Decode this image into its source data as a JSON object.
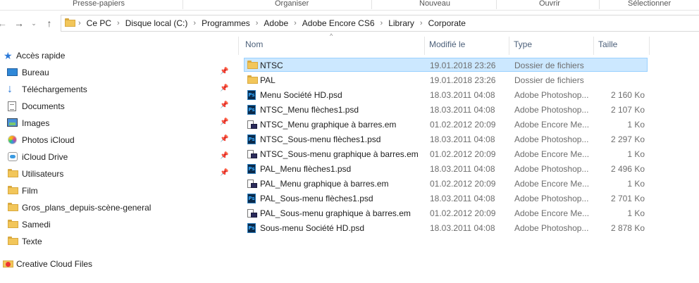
{
  "ribbon": {
    "groups": [
      "Presse-papiers",
      "Organiser",
      "Nouveau",
      "Ouvrir",
      "Sélectionner"
    ]
  },
  "nav": {
    "back_icon": "arrow-left-icon",
    "forward_icon": "arrow-right-icon",
    "up_icon": "arrow-up-icon",
    "breadcrumb": [
      "Ce PC",
      "Disque local (C:)",
      "Programmes",
      "Adobe",
      "Adobe Encore CS6",
      "Library",
      "Corporate"
    ]
  },
  "sidebar": {
    "items": [
      {
        "label": "Accès rapide",
        "icon": "star-icon",
        "pinned": false
      },
      {
        "label": "Bureau",
        "icon": "desktop-icon",
        "pinned": true
      },
      {
        "label": "Téléchargements",
        "icon": "download-icon",
        "pinned": true
      },
      {
        "label": "Documents",
        "icon": "documents-icon",
        "pinned": true
      },
      {
        "label": "Images",
        "icon": "pictures-icon",
        "pinned": true
      },
      {
        "label": "Photos iCloud",
        "icon": "icloud-photos-icon",
        "pinned": true
      },
      {
        "label": "iCloud Drive",
        "icon": "icloud-drive-icon",
        "pinned": true
      },
      {
        "label": "Utilisateurs",
        "icon": "folder-icon",
        "pinned": true
      },
      {
        "label": "Film",
        "icon": "folder-icon",
        "pinned": false
      },
      {
        "label": "Gros_plans_depuis-scène-general",
        "icon": "folder-icon",
        "pinned": false
      },
      {
        "label": "Samedi",
        "icon": "folder-icon",
        "pinned": false
      },
      {
        "label": "Texte",
        "icon": "folder-icon",
        "pinned": false
      },
      {
        "label": "Creative Cloud Files",
        "icon": "creative-cloud-folder-icon",
        "pinned": false
      }
    ]
  },
  "columns": {
    "name": "Nom",
    "modified": "Modifié le",
    "type": "Type",
    "size": "Taille"
  },
  "files": [
    {
      "name": "NTSC",
      "modified": "19.01.2018 23:26",
      "type": "Dossier de fichiers",
      "size": "",
      "icon": "folder-icon",
      "selected": true
    },
    {
      "name": "PAL",
      "modified": "19.01.2018 23:26",
      "type": "Dossier de fichiers",
      "size": "",
      "icon": "folder-icon",
      "selected": false
    },
    {
      "name": "Menu Société HD.psd",
      "modified": "18.03.2011 04:08",
      "type": "Adobe Photoshop...",
      "size": "2 160 Ko",
      "icon": "photoshop-file-icon",
      "selected": false
    },
    {
      "name": "NTSC_Menu flèches1.psd",
      "modified": "18.03.2011 04:08",
      "type": "Adobe Photoshop...",
      "size": "2 107 Ko",
      "icon": "photoshop-file-icon",
      "selected": false
    },
    {
      "name": "NTSC_Menu graphique à barres.em",
      "modified": "01.02.2012 20:09",
      "type": "Adobe Encore Me...",
      "size": "1 Ko",
      "icon": "encore-file-icon",
      "selected": false
    },
    {
      "name": "NTSC_Sous-menu flèches1.psd",
      "modified": "18.03.2011 04:08",
      "type": "Adobe Photoshop...",
      "size": "2 297 Ko",
      "icon": "photoshop-file-icon",
      "selected": false
    },
    {
      "name": "NTSC_Sous-menu graphique à barres.em",
      "modified": "01.02.2012 20:09",
      "type": "Adobe Encore Me...",
      "size": "1 Ko",
      "icon": "encore-file-icon",
      "selected": false
    },
    {
      "name": "PAL_Menu flèches1.psd",
      "modified": "18.03.2011 04:08",
      "type": "Adobe Photoshop...",
      "size": "2 496 Ko",
      "icon": "photoshop-file-icon",
      "selected": false
    },
    {
      "name": "PAL_Menu graphique à barres.em",
      "modified": "01.02.2012 20:09",
      "type": "Adobe Encore Me...",
      "size": "1 Ko",
      "icon": "encore-file-icon",
      "selected": false
    },
    {
      "name": "PAL_Sous-menu flèches1.psd",
      "modified": "18.03.2011 04:08",
      "type": "Adobe Photoshop...",
      "size": "2 701 Ko",
      "icon": "photoshop-file-icon",
      "selected": false
    },
    {
      "name": "PAL_Sous-menu graphique à barres.em",
      "modified": "01.02.2012 20:09",
      "type": "Adobe Encore Me...",
      "size": "1 Ko",
      "icon": "encore-file-icon",
      "selected": false
    },
    {
      "name": "Sous-menu Société HD.psd",
      "modified": "18.03.2011 04:08",
      "type": "Adobe Photoshop...",
      "size": "2 878 Ko",
      "icon": "photoshop-file-icon",
      "selected": false
    }
  ],
  "colors": {
    "selection_bg": "#cce8ff",
    "selection_border": "#99d1ff",
    "header_text": "#4c607a",
    "folder": "#f2c65a",
    "accent": "#2b79d8"
  }
}
